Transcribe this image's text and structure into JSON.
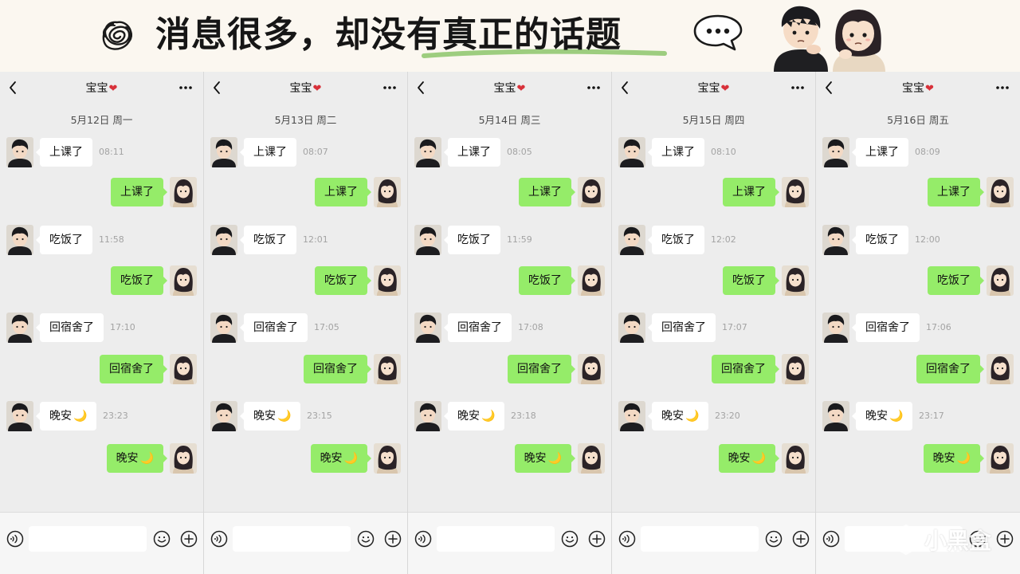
{
  "banner": {
    "headline": "消息很多，却没有真正的话题",
    "icons": [
      "scribble-icon",
      "speech-bubble-ellipsis-icon",
      "couple-illustration"
    ]
  },
  "colors": {
    "background": "#ededed",
    "incoming_bubble": "#ffffff",
    "outgoing_bubble": "#95ec69",
    "heart": "#d8313a",
    "timestamp": "#a3a3a3"
  },
  "panels": [
    {
      "contact": "宝宝",
      "heart": "❤",
      "date": "5月12日  周一",
      "messages": [
        {
          "dir": "in",
          "text": "上课了",
          "time": "08:11"
        },
        {
          "dir": "out",
          "text": "上课了"
        },
        {
          "dir": "in",
          "text": "吃饭了",
          "time": "11:58"
        },
        {
          "dir": "out",
          "text": "吃饭了"
        },
        {
          "dir": "in",
          "text": "回宿舍了",
          "time": "17:10"
        },
        {
          "dir": "out",
          "text": "回宿舍了"
        },
        {
          "dir": "in",
          "text": "晚安",
          "time": "23:23",
          "moon": "🌙"
        },
        {
          "dir": "out",
          "text": "晚安",
          "moon": "🌙"
        }
      ]
    },
    {
      "contact": "宝宝",
      "heart": "❤",
      "date": "5月13日  周二",
      "messages": [
        {
          "dir": "in",
          "text": "上课了",
          "time": "08:07"
        },
        {
          "dir": "out",
          "text": "上课了"
        },
        {
          "dir": "in",
          "text": "吃饭了",
          "time": "12:01"
        },
        {
          "dir": "out",
          "text": "吃饭了"
        },
        {
          "dir": "in",
          "text": "回宿舍了",
          "time": "17:05"
        },
        {
          "dir": "out",
          "text": "回宿舍了"
        },
        {
          "dir": "in",
          "text": "晚安",
          "time": "23:15",
          "moon": "🌙"
        },
        {
          "dir": "out",
          "text": "晚安",
          "moon": "🌙"
        }
      ]
    },
    {
      "contact": "宝宝",
      "heart": "❤",
      "date": "5月14日  周三",
      "messages": [
        {
          "dir": "in",
          "text": "上课了",
          "time": "08:05"
        },
        {
          "dir": "out",
          "text": "上课了"
        },
        {
          "dir": "in",
          "text": "吃饭了",
          "time": "11:59"
        },
        {
          "dir": "out",
          "text": "吃饭了"
        },
        {
          "dir": "in",
          "text": "回宿舍了",
          "time": "17:08"
        },
        {
          "dir": "out",
          "text": "回宿舍了"
        },
        {
          "dir": "in",
          "text": "晚安",
          "time": "23:18",
          "moon": "🌙"
        },
        {
          "dir": "out",
          "text": "晚安",
          "moon": "🌙"
        }
      ]
    },
    {
      "contact": "宝宝",
      "heart": "❤",
      "date": "5月15日  周四",
      "messages": [
        {
          "dir": "in",
          "text": "上课了",
          "time": "08:10"
        },
        {
          "dir": "out",
          "text": "上课了"
        },
        {
          "dir": "in",
          "text": "吃饭了",
          "time": "12:02"
        },
        {
          "dir": "out",
          "text": "吃饭了"
        },
        {
          "dir": "in",
          "text": "回宿舍了",
          "time": "17:07"
        },
        {
          "dir": "out",
          "text": "回宿舍了"
        },
        {
          "dir": "in",
          "text": "晚安",
          "time": "23:20",
          "moon": "🌙"
        },
        {
          "dir": "out",
          "text": "晚安",
          "moon": "🌙"
        }
      ]
    },
    {
      "contact": "宝宝",
      "heart": "❤",
      "date": "5月16日  周五",
      "messages": [
        {
          "dir": "in",
          "text": "上课了",
          "time": "08:09"
        },
        {
          "dir": "out",
          "text": "上课了"
        },
        {
          "dir": "in",
          "text": "吃饭了",
          "time": "12:00"
        },
        {
          "dir": "out",
          "text": "吃饭了"
        },
        {
          "dir": "in",
          "text": "回宿舍了",
          "time": "17:06"
        },
        {
          "dir": "out",
          "text": "回宿舍了"
        },
        {
          "dir": "in",
          "text": "晚安",
          "time": "23:17",
          "moon": "🌙"
        },
        {
          "dir": "out",
          "text": "晚安",
          "moon": "🌙"
        }
      ]
    }
  ],
  "panel_icons": [
    "back-chevron-icon",
    "more-dots-icon",
    "voice-icon",
    "emoji-icon",
    "plus-icon"
  ],
  "watermark": {
    "text": "小黑盒",
    "icon": "hexagon-logo-icon"
  }
}
